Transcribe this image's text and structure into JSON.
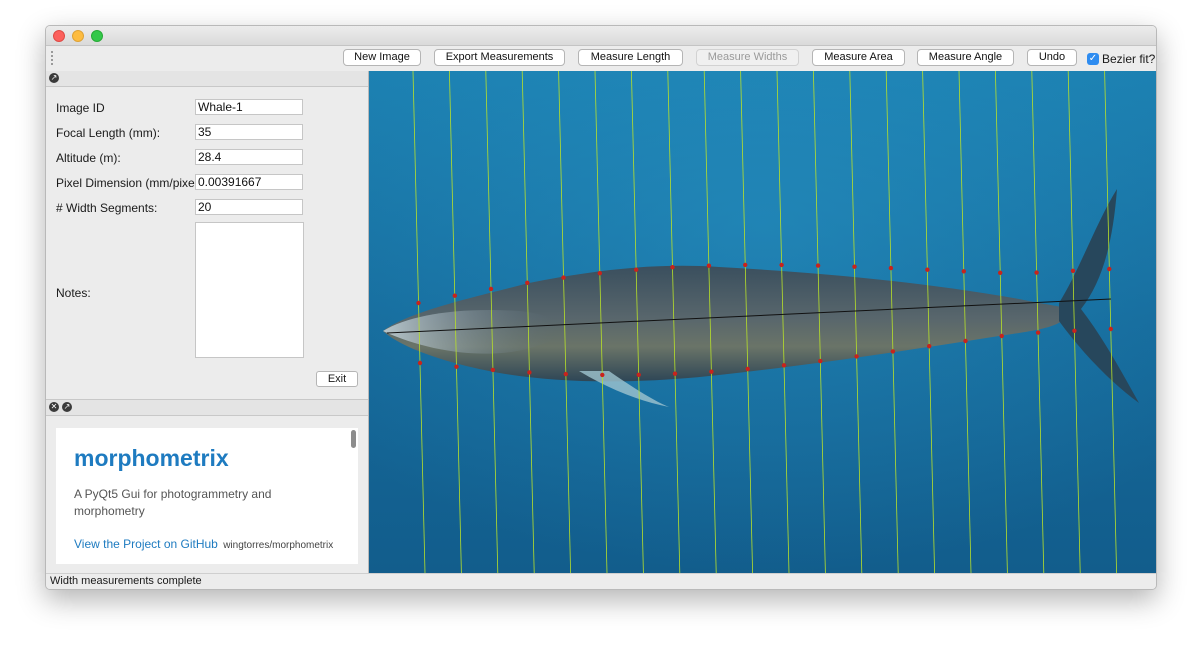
{
  "toolbar": {
    "buttons": [
      {
        "label": "New Image",
        "enabled": true
      },
      {
        "label": "Export Measurements",
        "enabled": true
      },
      {
        "label": "Measure Length",
        "enabled": true
      },
      {
        "label": "Measure Widths",
        "enabled": false
      },
      {
        "label": "Measure Area",
        "enabled": true
      },
      {
        "label": "Measure Angle",
        "enabled": true
      },
      {
        "label": "Undo",
        "enabled": true
      }
    ],
    "bezier_label": "Bezier fit?",
    "bezier_checked": true
  },
  "form": {
    "image_id_label": "Image ID",
    "image_id_value": "Whale-1",
    "focal_length_label": "Focal Length (mm):",
    "focal_length_value": "35",
    "altitude_label": "Altitude (m):",
    "altitude_value": "28.4",
    "pixel_dim_label": "Pixel Dimension (mm/pixel)",
    "pixel_dim_value": "0.00391667",
    "width_segments_label": "# Width Segments:",
    "width_segments_value": "20",
    "notes_label": "Notes:",
    "notes_value": "",
    "exit_label": "Exit"
  },
  "webpanel": {
    "title": "morphometrix",
    "description": "A PyQt5 Gui for photogrammetry and morphometry",
    "link_text": "View the Project on GitHub",
    "repo": "wingtorres/morphometrix"
  },
  "status": {
    "text": "Width measurements complete"
  },
  "measurement": {
    "segments": 20
  },
  "colors": {
    "accent": "#1e7bc0",
    "ocean": "#1a6f9c",
    "grid_lines": "#b7e02a",
    "markers": "#c8231c",
    "checkbox": "#2e8cf0"
  }
}
